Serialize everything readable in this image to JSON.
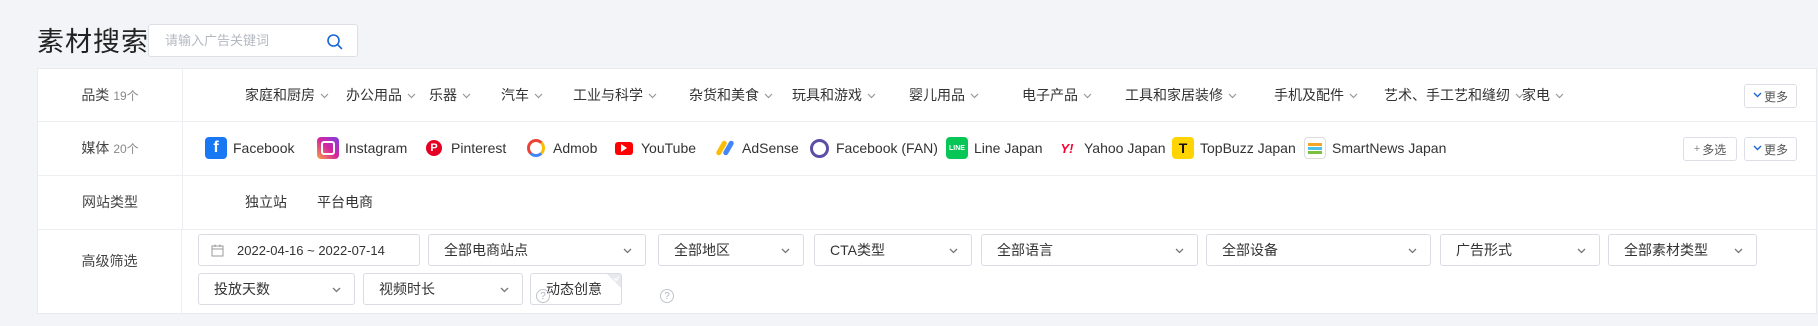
{
  "page": {
    "title": "素材搜索"
  },
  "search": {
    "placeholder": "请输入广告关键词",
    "value": ""
  },
  "category": {
    "label": "品类",
    "count": "19个",
    "items": [
      "家庭和厨房",
      "办公用品",
      "乐器",
      "汽车",
      "工业与科学",
      "杂货和美食",
      "玩具和游戏",
      "婴儿用品",
      "电子产品",
      "工具和家居装修",
      "手机及配件",
      "艺术、手工艺和缝纫",
      "家电"
    ],
    "more": "更多"
  },
  "media": {
    "label": "媒体",
    "count": "20个",
    "items": [
      {
        "name": "Facebook",
        "icon": "facebook-icon"
      },
      {
        "name": "Instagram",
        "icon": "instagram-icon"
      },
      {
        "name": "Pinterest",
        "icon": "pinterest-icon"
      },
      {
        "name": "Admob",
        "icon": "admob-icon"
      },
      {
        "name": "YouTube",
        "icon": "youtube-icon"
      },
      {
        "name": "AdSense",
        "icon": "adsense-icon"
      },
      {
        "name": "Facebook (FAN)",
        "icon": "facebook-fan-icon"
      },
      {
        "name": "Line Japan",
        "icon": "line-icon"
      },
      {
        "name": "Yahoo Japan",
        "icon": "yahoo-icon"
      },
      {
        "name": "TopBuzz Japan",
        "icon": "topbuzz-icon"
      },
      {
        "name": "SmartNews Japan",
        "icon": "smartnews-icon"
      }
    ],
    "multi": "多选",
    "more": "更多"
  },
  "site_type": {
    "label": "网站类型",
    "items": [
      "独立站",
      "平台电商"
    ]
  },
  "advanced": {
    "label": "高级筛选",
    "date_range": "2022-04-16 ~ 2022-07-14",
    "dropdowns_row1": [
      "全部电商站点",
      "全部地区",
      "CTA类型",
      "全部语言",
      "全部设备",
      "广告形式",
      "全部素材类型"
    ],
    "dropdowns_row2": [
      "投放天数",
      "视频时长",
      "动态创意"
    ]
  },
  "colors": {
    "accent": "#1a66d6",
    "background": "#f3f4f7"
  }
}
